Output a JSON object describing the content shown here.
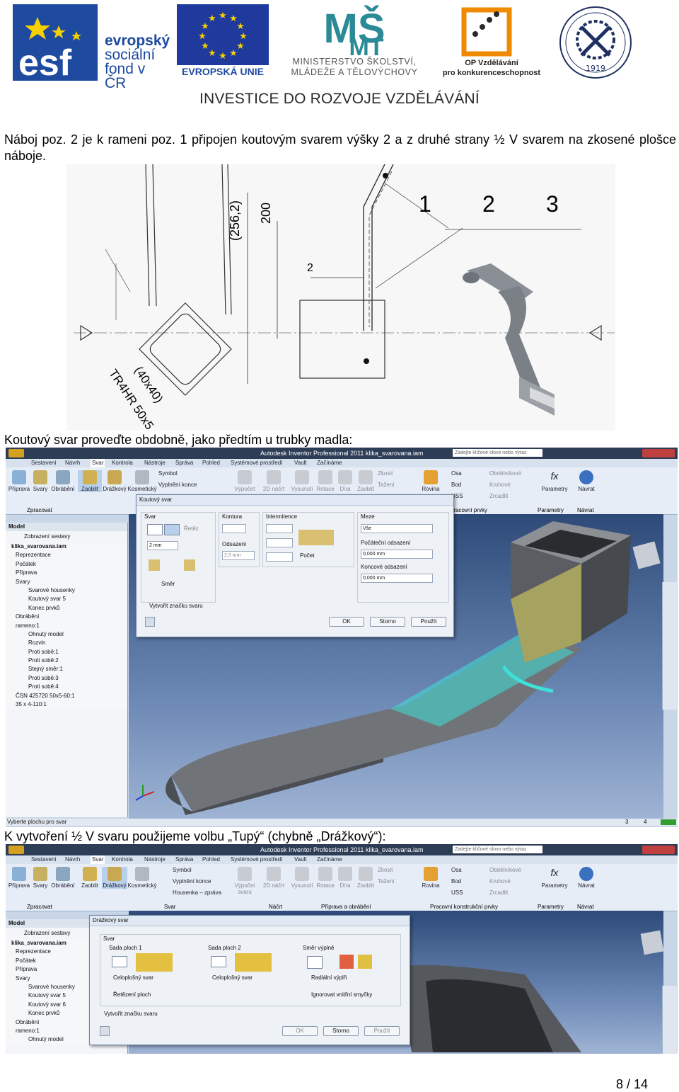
{
  "header": {
    "esf_logo_text": [
      "evropský",
      "sociální",
      "fond v ČR"
    ],
    "eu_logo_text": "EVROPSKÁ UNIE",
    "msmt_logo_text": [
      "MINISTERSTVO ŠKOLSTVÍ,",
      "MLÁDEŽE A TĚLOVÝCHOVY"
    ],
    "op_logo_text": [
      "OP Vzdělávání",
      "pro konkurenceschopnost"
    ],
    "univ_seal_text": "1919",
    "investice": "INVESTICE DO ROZVOJE VZDĚLÁVÁNÍ"
  },
  "paragraph": "Náboj poz. 2 je k rameni poz. 1 připojen koutovým svarem výšky 2 a z druhé strany ½ V svarem na zkosené plošce náboje.",
  "drawing": {
    "dim_256": "(256,2)",
    "dim_200": "200",
    "dim_40x40": "(40x40)",
    "profile": "TR4HR 50x5",
    "pos_labels": [
      "1",
      "2",
      "3"
    ],
    "small_label": "2"
  },
  "caption1": "Koutový svar proveďte obdobně, jako předtím u trubky madla:",
  "caption2": "K vytvoření ½ V svaru použijeme volbu „Tupý“ (chybně „Drážkový“):",
  "screenshot1": {
    "app_title": "Autodesk Inventor Professional 2011   klika_svarovana.iam",
    "search_placeholder": "Zadejte klíčové slovo nebo výraz",
    "menu": [
      "Sestavení",
      "Návrh",
      "Svar",
      "Kontrola",
      "Nástroje",
      "Správa",
      "Pohled",
      "Systémové prostředí",
      "Vault",
      "Začínáme"
    ],
    "ribbon": [
      "Příprava",
      "Svary",
      "Obrábění",
      "Zaoblit",
      "Drážkový",
      "Kosmetický",
      "Výpočet",
      "2D náčrt",
      "Vysunutí",
      "Rotace",
      "Díra",
      "Zaoblit",
      "Rovina",
      "Parametry",
      "Návrat"
    ],
    "ribbon_small": [
      "Symbol",
      "Vyplnění konce",
      "Zkosit",
      "Tažení",
      "Osa",
      "Bod",
      "USS",
      "Obdélníkové",
      "Kruhové",
      "Zrcadlit"
    ],
    "group_label": "Zpracovat",
    "group_labels_right": [
      "Pracovní prvky",
      "Parametry",
      "Návrat"
    ],
    "panel_title": "Model",
    "panel_view": "Zobrazení sestavy",
    "tree": [
      "klika_svarovana.iam",
      "Reprezentace",
      "Počátek",
      "Příprava",
      "Svary",
      "Svarové housenky",
      "Koutový svar 5",
      "Konec prvků",
      "Obrábění",
      "rameno:1",
      "Ohnutý model",
      "Rozvin",
      "Proti sobě:1",
      "Proti sobě:2",
      "Stejný směr:1",
      "Proti sobě:3",
      "Proti sobě:4",
      "ČSN 425720 50x5-60:1",
      "35 x 4-110:1"
    ],
    "dialog": {
      "title": "Koutový svar",
      "svar": "Svar",
      "chain": "Řetěz",
      "size": "2 mm",
      "direction": "Směr",
      "kontura": "Kontura",
      "odsazeni": "Odsazení",
      "odsazeni_val": "2,5 mm",
      "intermitence": "Intermitence",
      "pocet": "Počet",
      "meze": "Meze",
      "meze_val": "Vše",
      "start_offset": "Počáteční odsazení",
      "start_val": "0,000 mm",
      "end_offset": "Koncové odsazení",
      "end_val": "0,000 mm",
      "symbol_check": "Vytvořit značku svaru",
      "ok": "OK",
      "cancel": "Storno",
      "apply": "Použít"
    },
    "status": "Vyberte plochu pro svar",
    "status_nums": [
      "3",
      "4"
    ]
  },
  "screenshot2": {
    "app_title": "Autodesk Inventor Professional 2011   klika_svarovana.iam",
    "search_placeholder": "Zadejte klíčové slovo nebo výraz",
    "menu": [
      "Sestavení",
      "Návrh",
      "Svar",
      "Kontrola",
      "Nástroje",
      "Správa",
      "Pohled",
      "Systémové prostředí",
      "Vault",
      "Začínáme"
    ],
    "ribbon": [
      "Příprava",
      "Svary",
      "Obrábění",
      "Zaoblit",
      "Drážkový",
      "Kosmetický",
      "Výpočet svaru",
      "2D náčrt",
      "Vysunutí",
      "Rotace",
      "Díra",
      "Zaoblit",
      "Rovina",
      "Parametry",
      "Návrat"
    ],
    "ribbon_small": [
      "Symbol",
      "Vyplnění konce",
      "Housenka – zpráva",
      "Zkosit",
      "Tažení",
      "Osa",
      "Bod",
      "USS",
      "Obdélníkové",
      "Kruhové",
      "Zrcadlit"
    ],
    "group_labels": [
      "Zpracovat",
      "Svar",
      "Náčrt",
      "Příprava a obrábění",
      "Pracovní konstrukční prvky",
      "Parametry",
      "Návrat"
    ],
    "panel_title": "Model",
    "panel_view": "Zobrazení sestavy",
    "tree": [
      "klika_svarovana.iam",
      "Reprezentace",
      "Počátek",
      "Příprava",
      "Svary",
      "Svarové housenky",
      "Koutový svar 5",
      "Koutový svar 6",
      "Konec prvků",
      "Obrábění",
      "rameno:1",
      "Ohnutý model"
    ],
    "dialog": {
      "title": "Drážkový svar",
      "svar": "Svar",
      "set1": "Sada ploch 1",
      "set2": "Sada ploch 2",
      "dir": "Směr výplně",
      "full1": "Celoplošný svar",
      "full2": "Celoplošný svar",
      "radial": "Radiální výplň",
      "chain": "Řetězení ploch",
      "ignore": "Ignorovat vnitřní smyčky",
      "symbol_check": "Vytvořit značku svaru",
      "ok": "OK",
      "cancel": "Storno",
      "apply": "Použít"
    }
  },
  "page_number": "8 / 14",
  "colors": {
    "esf_blue": "#1e4aa0",
    "eu_blue": "#1f3a9c",
    "eu_star": "#f6d000",
    "msmt_teal": "#2a8a96",
    "op_orange": "#f08a00",
    "weld_cyan": "#3fe0d8",
    "weld_yellow": "#c6c060"
  }
}
